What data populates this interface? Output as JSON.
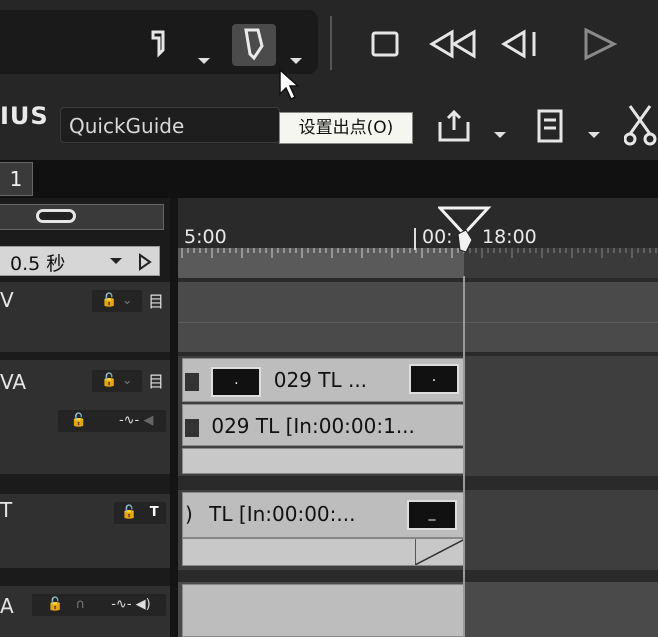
{
  "tooltip": {
    "text": "设置出点(O)"
  },
  "toolbar": {
    "brand": "IUS",
    "quickguide": "QuickGuide"
  },
  "tabs": [
    {
      "label": "1"
    }
  ],
  "left_panel": {
    "duration_value": "0.5 秒",
    "tracks": [
      {
        "label": "V"
      },
      {
        "label": "VA"
      },
      {
        "label": "T"
      },
      {
        "label": "A"
      }
    ]
  },
  "timeline": {
    "timecodes": [
      "5:00",
      "00:",
      "18:00"
    ],
    "clips": {
      "va_video": "029  TL ...",
      "va_audio": "029  TL [In:00:00:1...",
      "title": "TL [In:00:00:..."
    }
  },
  "colors": {
    "background": "#2a2a2a",
    "tooltip_bg": "#f6f6f0",
    "clip": "#bdbdbd"
  }
}
